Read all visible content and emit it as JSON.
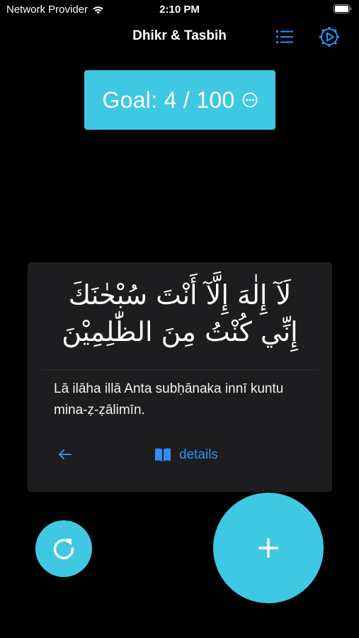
{
  "status_bar": {
    "carrier": "Network Provider",
    "time": "2:10 PM"
  },
  "nav": {
    "title": "Dhikr & Tasbih",
    "list_icon": "list-icon",
    "settings_icon": "gear-play-icon"
  },
  "goal": {
    "label": "Goal: 4 / 100",
    "icon": "ellipsis-circle-icon"
  },
  "dhikr": {
    "arabic_line_1": "لَآ إِلٰهَ إِلَّآ أَنْتَ سُبْحٰنَكَ",
    "arabic_line_2": "إِنِّي كُنْتُ مِنَ الظّٰلِمِيْنَ",
    "transliteration": "Lā ilāha illā Anta subḥānaka innī kuntu mina-ẓ-ẓālimīn.",
    "details_label": "details",
    "back_icon": "arrow-left-icon",
    "details_icon": "book-open-icon"
  },
  "actions": {
    "reset_icon": "refresh-icon",
    "add_icon": "plus-icon"
  },
  "colors": {
    "accent": "#3fc8e4",
    "link_blue": "#2e8ef5",
    "card_bg": "#1d1d1f",
    "background": "#000000"
  }
}
